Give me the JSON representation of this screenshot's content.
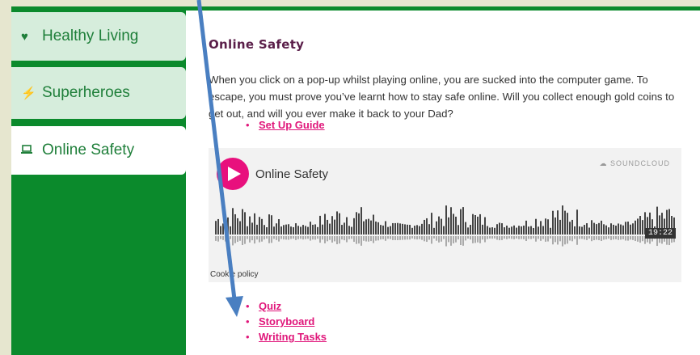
{
  "sidebar": {
    "items": [
      {
        "label": "Healthy Living",
        "icon": "heart-icon",
        "active": false
      },
      {
        "label": "Superheroes",
        "icon": "lightning-icon",
        "active": false
      },
      {
        "label": "Online Safety",
        "icon": "laptop-icon",
        "active": true
      }
    ]
  },
  "main": {
    "title": "Online Safety",
    "description": "When you click on a pop-up whilst playing online, you are sucked into the computer game. To escape, you must prove you’ve learnt how to stay safe online. Will you collect enough gold coins to get out, and will you ever make it back to your Dad?",
    "links_top": [
      "Set Up Guide"
    ],
    "links_bottom": [
      "Quiz",
      "Storyboard",
      "Writing Tasks"
    ]
  },
  "player": {
    "track_title": "Online Safety",
    "brand": "SOUNDCLOUD",
    "duration": "19:22",
    "cookie": "Cookie policy"
  },
  "colors": {
    "sidebar_green": "#0b8a2c",
    "tab_light": "#d6eddc",
    "link_pink": "#e0167a",
    "title_plum": "#5a1e49",
    "play_pink": "#e8107d",
    "arrow_blue": "#4a7fc1"
  }
}
